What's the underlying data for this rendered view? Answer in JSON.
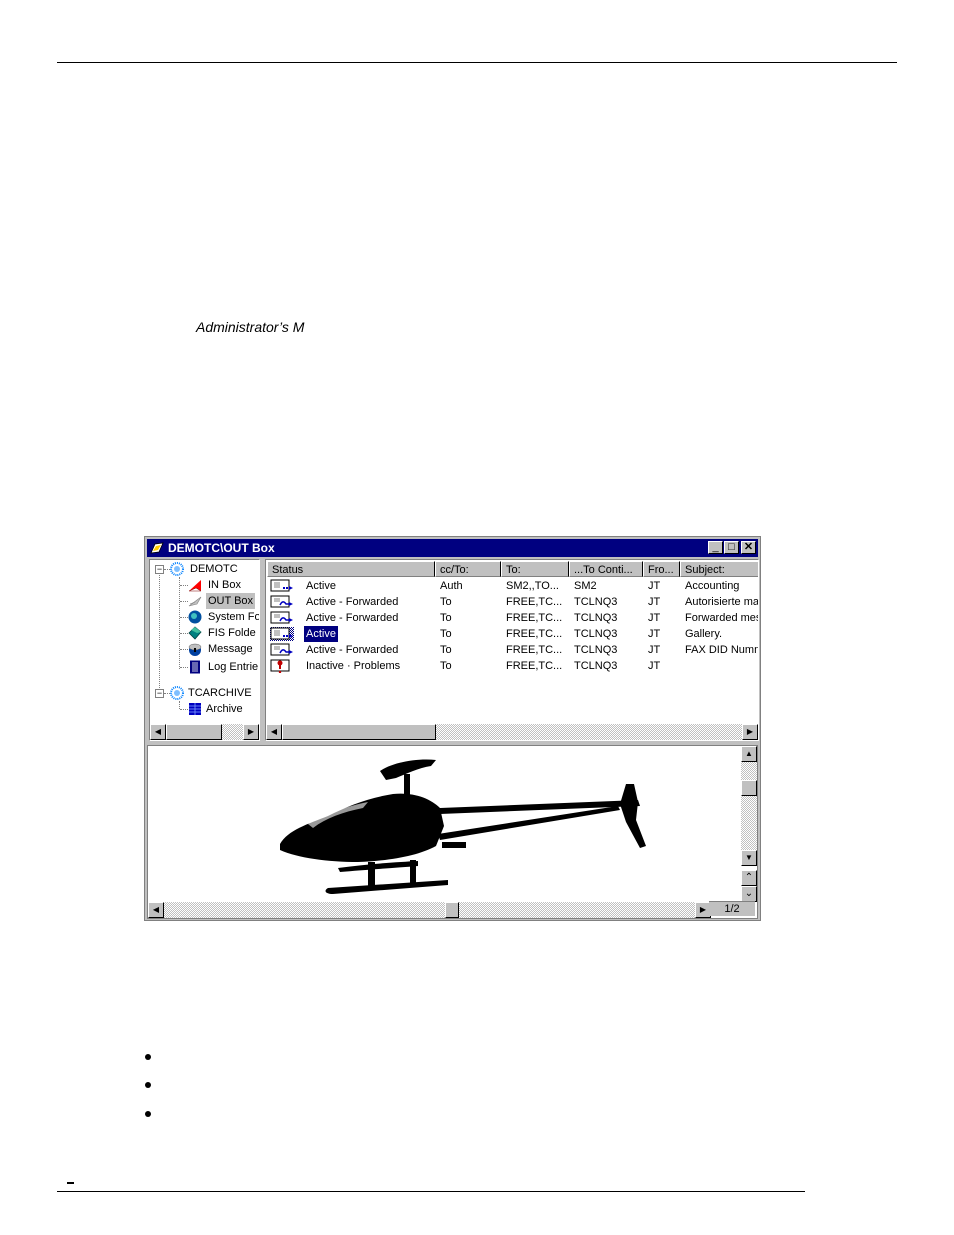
{
  "document": {
    "heading": "Administrator’s M",
    "bullets": [
      "",
      "",
      ""
    ],
    "footer_mark": "–"
  },
  "window": {
    "title": "DEMOTC\\OUT Box",
    "controls": {
      "minimize": "_",
      "maximize": "□",
      "close": "✕"
    },
    "tree": {
      "nodes": [
        {
          "label": "DEMOTC",
          "icon": "globe-icon",
          "level": 0,
          "expanded": true
        },
        {
          "label": "IN Box",
          "icon": "inbox-icon",
          "level": 1
        },
        {
          "label": "OUT Box",
          "icon": "outbox-icon",
          "level": 1,
          "selected": true
        },
        {
          "label": "System Fo",
          "icon": "system-folder-icon",
          "level": 1
        },
        {
          "label": "FIS Folde",
          "icon": "fis-folder-icon",
          "level": 1
        },
        {
          "label": "Message",
          "icon": "message-icon",
          "level": 1
        },
        {
          "label": "Log Entrie",
          "icon": "log-icon",
          "level": 1
        },
        {
          "label": "TCARCHIVE",
          "icon": "globe-icon",
          "level": 0,
          "expanded": true
        },
        {
          "label": "Archive",
          "icon": "archive-icon",
          "level": 1
        }
      ]
    },
    "list": {
      "columns": [
        "Status",
        "cc/To:",
        "To:",
        "...To Conti...",
        "Fro...",
        "Subject:"
      ],
      "rows": [
        {
          "icon": "message-active-icon",
          "status": "Active",
          "cc": "Auth",
          "to": "SM2,,TO...",
          "to_cont": "SM2",
          "from": "JT",
          "subject": "Accounting"
        },
        {
          "icon": "message-forwarded-icon",
          "status": "Active - Forwarded",
          "cc": "To",
          "to": "FREE,TC...",
          "to_cont": "TCLNQ3",
          "from": "JT",
          "subject": "Autorisierte mai"
        },
        {
          "icon": "message-forwarded-icon",
          "status": "Active - Forwarded",
          "cc": "To",
          "to": "FREE,TC...",
          "to_cont": "TCLNQ3",
          "from": "JT",
          "subject": "Forwarded mes"
        },
        {
          "icon": "message-active-icon",
          "status": "Active",
          "cc": "To",
          "to": "FREE,TC...",
          "to_cont": "TCLNQ3",
          "from": "JT",
          "subject": "Gallery.",
          "selected": true
        },
        {
          "icon": "message-forwarded-icon",
          "status": "Active - Forwarded",
          "cc": "To",
          "to": "FREE,TC...",
          "to_cont": "TCLNQ3",
          "from": "JT",
          "subject": "FAX DID Numn"
        },
        {
          "icon": "message-problem-icon",
          "status": "Inactive · Problems",
          "cc": "To",
          "to": "FREE,TC...",
          "to_cont": "TCLNQ3",
          "from": "JT",
          "subject": ""
        }
      ]
    },
    "preview": {
      "image": "helicopter-silhouette",
      "page_indicator": "1/2"
    }
  }
}
